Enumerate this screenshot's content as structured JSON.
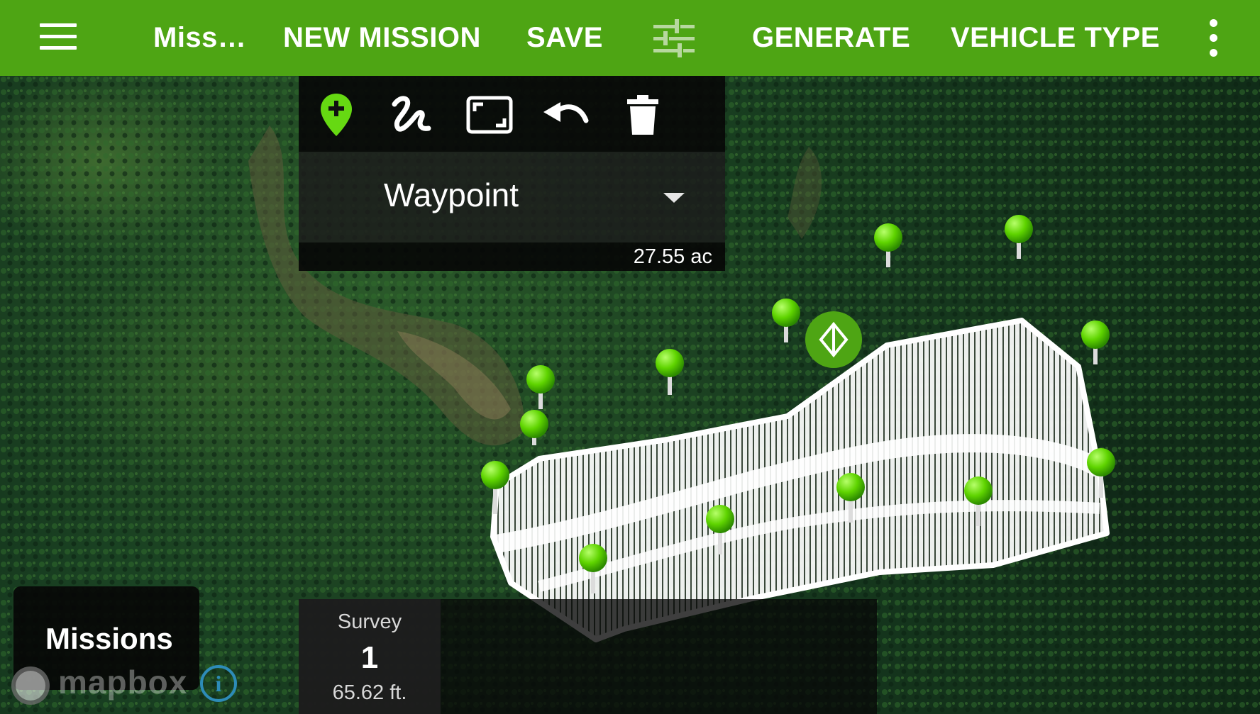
{
  "app_bar": {
    "title": "Miss…",
    "new_mission": "NEW MISSION",
    "save": "SAVE",
    "generate": "GENERATE",
    "vehicle_type": "VEHICLE TYPE",
    "icons": {
      "menu": "hamburger-menu-icon",
      "filter": "tune-sliders-icon",
      "more": "more-vert-icon"
    },
    "color": "#4ea514"
  },
  "toolbar": {
    "tools": [
      "add-waypoint-icon",
      "draw-path-icon",
      "fit-view-icon",
      "undo-icon",
      "delete-icon"
    ],
    "mode_value": "Waypoint",
    "area": "27.55 ac"
  },
  "missions_button": {
    "label": "Missions"
  },
  "attribution": {
    "logo_text": "mapbox",
    "info": "i"
  },
  "survey": {
    "label": "Survey",
    "number": "1",
    "altitude": "65.62 ft."
  },
  "map": {
    "marker_color": "#5fd400",
    "start_marker_color": "#4ea514"
  }
}
